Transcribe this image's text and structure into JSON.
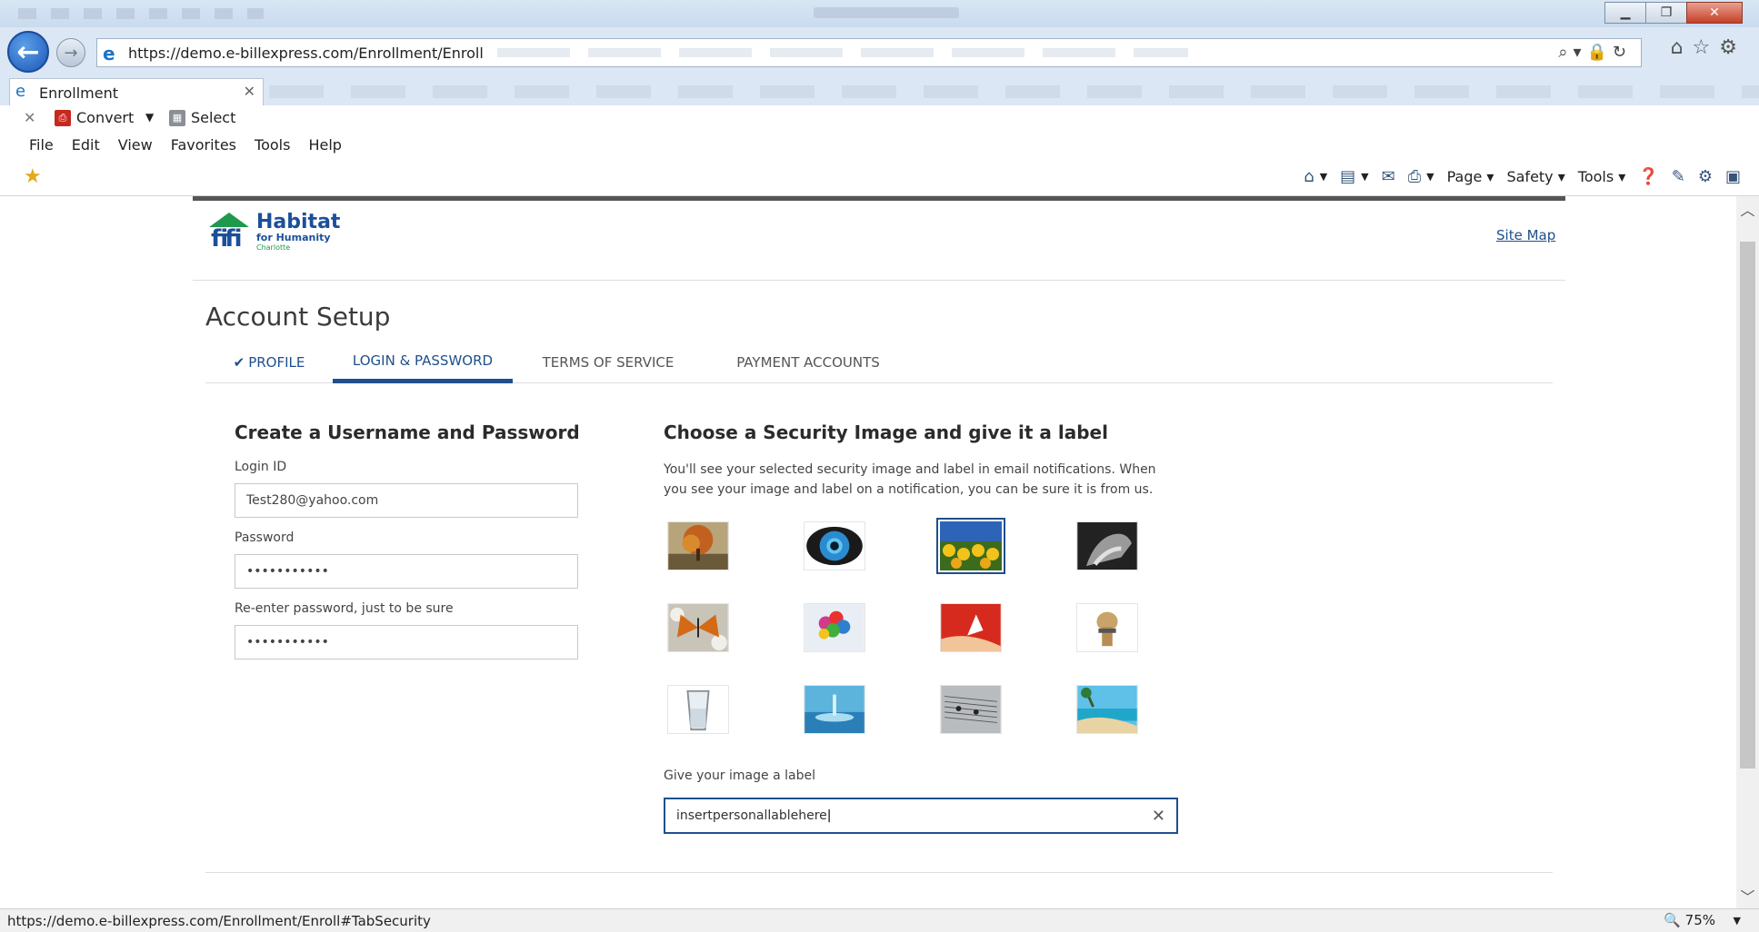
{
  "browser": {
    "url": "https://demo.e-billexpress.com/Enrollment/Enroll",
    "tab_label": "Enrollment",
    "convert_label": "Convert",
    "select_label": "Select",
    "menus": [
      "File",
      "Edit",
      "View",
      "Favorites",
      "Tools",
      "Help"
    ],
    "cmdbar": {
      "page": "Page",
      "safety": "Safety",
      "tools": "Tools"
    },
    "status_url": "https://demo.e-billexpress.com/Enrollment/Enroll#TabSecurity",
    "zoom": "75%"
  },
  "header": {
    "logo_main": "Habitat",
    "logo_sub": "for Humanity",
    "logo_city": "Charlotte",
    "site_map": "Site Map"
  },
  "setup": {
    "title": "Account Setup",
    "steps": [
      "PROFILE",
      "LOGIN & PASSWORD",
      "TERMS OF SERVICE",
      "PAYMENT ACCOUNTS"
    ],
    "active_step": "LOGIN & PASSWORD"
  },
  "credentials": {
    "heading": "Create a Username and Password",
    "login_label": "Login ID",
    "login_value": "Test280@yahoo.com",
    "password_label": "Password",
    "password_value": "•••••••••••",
    "reenter_label": "Re-enter password, just to be sure",
    "reenter_value": "•••••••••••"
  },
  "security": {
    "heading": "Choose a Security Image and give it a label",
    "description": "You'll see your selected security image and label in email notifications. When you see your image and label on a notification, you can be sure it is from us.",
    "images": [
      "tree",
      "eye",
      "sunflowers",
      "hands",
      "butterfly",
      "balloons",
      "dancer",
      "dog",
      "glass",
      "water-drop",
      "sheet-music",
      "beach"
    ],
    "selected_image": "sunflowers",
    "label_prompt": "Give your image a label",
    "label_value": "insertpersonallablehere"
  },
  "colors": {
    "accent": "#1f4f8c",
    "brand_green": "#1f9a4c"
  }
}
